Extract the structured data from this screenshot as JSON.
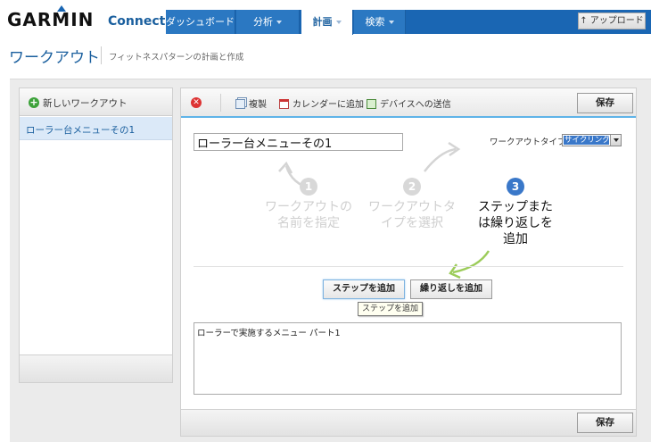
{
  "brand": {
    "name": "GARMIN",
    "product": "Connect",
    "accent": "#1a66b3"
  },
  "nav": {
    "tabs": [
      {
        "label": "ダッシュボード",
        "caret": false,
        "active": false
      },
      {
        "label": "分析",
        "caret": true,
        "active": false
      },
      {
        "label": "計画",
        "caret": true,
        "active": true
      },
      {
        "label": "検索",
        "caret": true,
        "active": false
      }
    ],
    "upload_label": "↑ アップロード"
  },
  "header": {
    "title": "ワークアウト",
    "subtitle": "フィットネスパターンの計画と作成"
  },
  "sidebar": {
    "new_workout_label": "新しいワークアウト",
    "items": [
      {
        "label": "ローラー台メニューその1",
        "selected": true
      }
    ]
  },
  "toolbar": {
    "delete_icon": "delete-icon",
    "copy_label": "複製",
    "calendar_label": "カレンダーに追加",
    "device_label": "デバイスへの送信",
    "save_label": "保存"
  },
  "editor": {
    "workout_name": "ローラー台メニューその1",
    "type_label": "ワークアウトタイプ:",
    "type_value": "サイクリング",
    "steps": [
      {
        "number": "1",
        "line1": "ワークアウトの",
        "line2": "名前を指定",
        "line3": "",
        "active": false
      },
      {
        "number": "2",
        "line1": "ワークアウトタ",
        "line2": "イプを選択",
        "line3": "",
        "active": false
      },
      {
        "number": "3",
        "line1": "ステップまた",
        "line2": "は繰り返しを",
        "line3": "追加",
        "active": true
      }
    ],
    "add_step_label": "ステップを追加",
    "add_repeat_label": "繰り返しを追加",
    "tooltip": "ステップを追加",
    "notes": "ローラーで実施するメニュー パート1",
    "save_label": "保存"
  }
}
